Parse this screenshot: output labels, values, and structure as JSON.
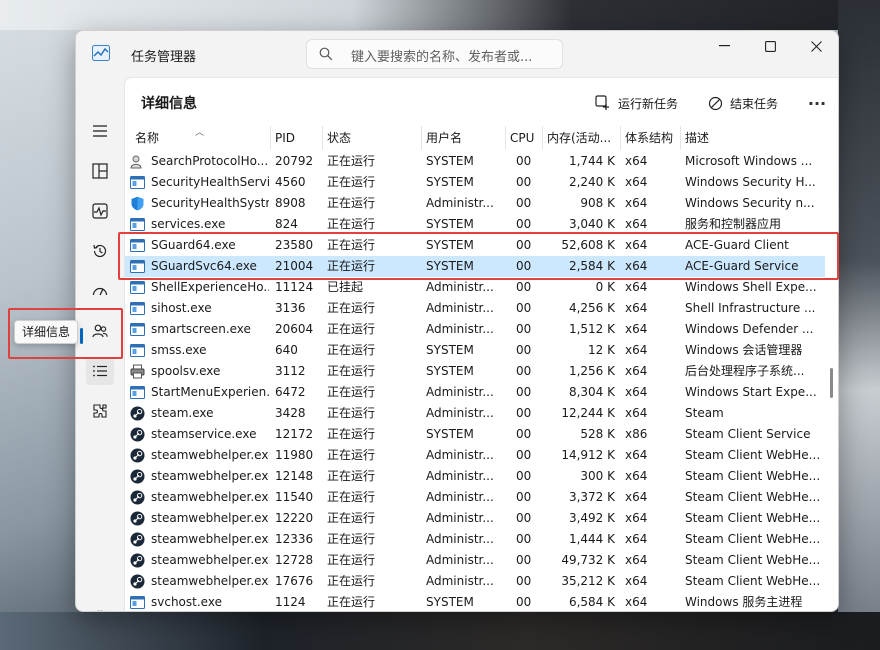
{
  "window": {
    "title": "任务管理器",
    "search_placeholder": "键入要搜索的名称、发布者或...",
    "minimize": "—",
    "maximize": "☐",
    "close": "✕"
  },
  "page": {
    "title": "详细信息",
    "run_new_task": "运行新任务",
    "end_task": "结束任务",
    "more": "..."
  },
  "sidebar": {
    "tooltip": "详细信息",
    "items": [
      {
        "name": "hamburger-menu-icon"
      },
      {
        "name": "processes-icon"
      },
      {
        "name": "performance-icon"
      },
      {
        "name": "app-history-icon"
      },
      {
        "name": "startup-apps-icon"
      },
      {
        "name": "users-icon"
      },
      {
        "name": "details-icon"
      },
      {
        "name": "services-icon"
      },
      {
        "name": "settings-icon"
      }
    ]
  },
  "columns": [
    "名称",
    "PID",
    "状态",
    "用户名",
    "CPU",
    "内存(活动...",
    "体系结构",
    "描述"
  ],
  "rows": [
    {
      "name": "SearchProtocolHo...",
      "pid": "20792",
      "status": "正在运行",
      "user": "SYSTEM",
      "cpu": "00",
      "mem": "1,744 K",
      "arch": "x64",
      "desc": "Microsoft Windows ...",
      "icon": "search-user-icon"
    },
    {
      "name": "SecurityHealthServi...",
      "pid": "4560",
      "status": "正在运行",
      "user": "SYSTEM",
      "cpu": "00",
      "mem": "2,240 K",
      "arch": "x64",
      "desc": "Windows Security H...",
      "icon": "app-window-icon"
    },
    {
      "name": "SecurityHealthSystr...",
      "pid": "8908",
      "status": "正在运行",
      "user": "Administr...",
      "cpu": "00",
      "mem": "908 K",
      "arch": "x64",
      "desc": "Windows Security n...",
      "icon": "shield-icon"
    },
    {
      "name": "services.exe",
      "pid": "824",
      "status": "正在运行",
      "user": "SYSTEM",
      "cpu": "00",
      "mem": "3,040 K",
      "arch": "x64",
      "desc": "服务和控制器应用",
      "icon": "app-window-icon"
    },
    {
      "name": "SGuard64.exe",
      "pid": "23580",
      "status": "正在运行",
      "user": "SYSTEM",
      "cpu": "00",
      "mem": "52,608 K",
      "arch": "x64",
      "desc": "ACE-Guard Client",
      "icon": "app-window-icon"
    },
    {
      "name": "SGuardSvc64.exe",
      "pid": "21004",
      "status": "正在运行",
      "user": "SYSTEM",
      "cpu": "00",
      "mem": "2,584 K",
      "arch": "x64",
      "desc": "ACE-Guard Service",
      "icon": "app-window-icon",
      "selected": true
    },
    {
      "name": "ShellExperienceHo...",
      "pid": "11124",
      "status": "已挂起",
      "user": "Administr...",
      "cpu": "00",
      "mem": "0 K",
      "arch": "x64",
      "desc": "Windows Shell Expe...",
      "icon": "app-window-icon"
    },
    {
      "name": "sihost.exe",
      "pid": "3136",
      "status": "正在运行",
      "user": "Administr...",
      "cpu": "00",
      "mem": "4,256 K",
      "arch": "x64",
      "desc": "Shell Infrastructure ...",
      "icon": "app-window-icon"
    },
    {
      "name": "smartscreen.exe",
      "pid": "20604",
      "status": "正在运行",
      "user": "Administr...",
      "cpu": "00",
      "mem": "1,512 K",
      "arch": "x64",
      "desc": "Windows Defender ...",
      "icon": "app-window-icon"
    },
    {
      "name": "smss.exe",
      "pid": "640",
      "status": "正在运行",
      "user": "SYSTEM",
      "cpu": "00",
      "mem": "12 K",
      "arch": "x64",
      "desc": "Windows 会话管理器",
      "icon": "app-window-icon"
    },
    {
      "name": "spoolsv.exe",
      "pid": "3112",
      "status": "正在运行",
      "user": "SYSTEM",
      "cpu": "00",
      "mem": "1,256 K",
      "arch": "x64",
      "desc": "后台处理程序子系统...",
      "icon": "printer-icon"
    },
    {
      "name": "StartMenuExperien...",
      "pid": "6472",
      "status": "正在运行",
      "user": "Administr...",
      "cpu": "00",
      "mem": "8,304 K",
      "arch": "x64",
      "desc": "Windows Start Expe...",
      "icon": "app-window-icon"
    },
    {
      "name": "steam.exe",
      "pid": "3428",
      "status": "正在运行",
      "user": "Administr...",
      "cpu": "00",
      "mem": "12,244 K",
      "arch": "x64",
      "desc": "Steam",
      "icon": "steam-icon"
    },
    {
      "name": "steamservice.exe",
      "pid": "12172",
      "status": "正在运行",
      "user": "SYSTEM",
      "cpu": "00",
      "mem": "528 K",
      "arch": "x86",
      "desc": "Steam Client Service",
      "icon": "steam-icon"
    },
    {
      "name": "steamwebhelper.exe",
      "pid": "11980",
      "status": "正在运行",
      "user": "Administr...",
      "cpu": "00",
      "mem": "14,912 K",
      "arch": "x64",
      "desc": "Steam Client WebHe...",
      "icon": "steam-icon"
    },
    {
      "name": "steamwebhelper.exe",
      "pid": "12148",
      "status": "正在运行",
      "user": "Administr...",
      "cpu": "00",
      "mem": "300 K",
      "arch": "x64",
      "desc": "Steam Client WebHe...",
      "icon": "steam-icon"
    },
    {
      "name": "steamwebhelper.exe",
      "pid": "11540",
      "status": "正在运行",
      "user": "Administr...",
      "cpu": "00",
      "mem": "3,372 K",
      "arch": "x64",
      "desc": "Steam Client WebHe...",
      "icon": "steam-icon"
    },
    {
      "name": "steamwebhelper.exe",
      "pid": "12220",
      "status": "正在运行",
      "user": "Administr...",
      "cpu": "00",
      "mem": "3,492 K",
      "arch": "x64",
      "desc": "Steam Client WebHe...",
      "icon": "steam-icon"
    },
    {
      "name": "steamwebhelper.exe",
      "pid": "12336",
      "status": "正在运行",
      "user": "Administr...",
      "cpu": "00",
      "mem": "1,444 K",
      "arch": "x64",
      "desc": "Steam Client WebHe...",
      "icon": "steam-icon"
    },
    {
      "name": "steamwebhelper.exe",
      "pid": "12728",
      "status": "正在运行",
      "user": "Administr...",
      "cpu": "00",
      "mem": "49,732 K",
      "arch": "x64",
      "desc": "Steam Client WebHe...",
      "icon": "steam-icon"
    },
    {
      "name": "steamwebhelper.exe",
      "pid": "17676",
      "status": "正在运行",
      "user": "Administr...",
      "cpu": "00",
      "mem": "35,212 K",
      "arch": "x64",
      "desc": "Steam Client WebHe...",
      "icon": "steam-icon"
    },
    {
      "name": "svchost.exe",
      "pid": "1124",
      "status": "正在运行",
      "user": "SYSTEM",
      "cpu": "00",
      "mem": "6,584 K",
      "arch": "x64",
      "desc": "Windows 服务主进程",
      "icon": "app-window-icon"
    }
  ],
  "colors": {
    "selected_row": "#cce8ff",
    "highlight_box": "#e0413c",
    "accent": "#0067c0"
  }
}
